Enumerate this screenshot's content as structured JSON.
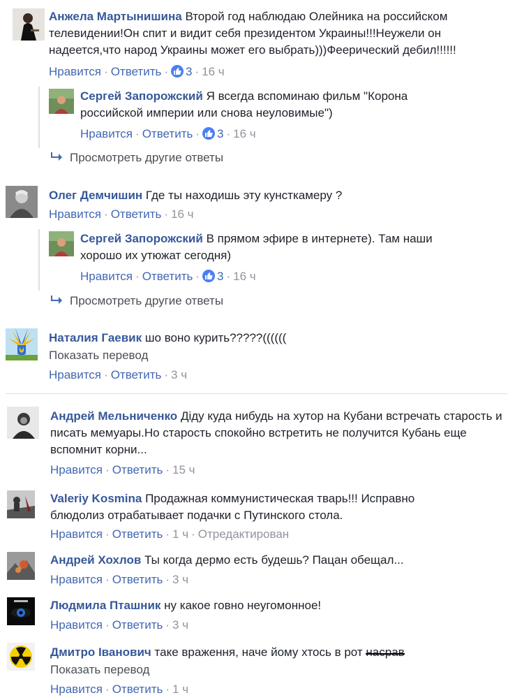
{
  "labels": {
    "like": "Нравится",
    "reply": "Ответить",
    "more_replies": "Просмотреть другие ответы",
    "translate": "Показать перевод",
    "edited": "Отредактирован"
  },
  "comments": [
    {
      "author": "Анжела Мартынишина",
      "text": "Второй год наблюдаю Олейника на российском телевидении!Он спит и видит себя президентом Украины!!!Неужели он надеется,что народ Украины может его выбрать)))Феерический дебил!!!!!!",
      "likes": "3",
      "time": "16 ч"
    },
    {
      "author": "Сергей Запорожский",
      "text": "Я всегда вспоминаю фильм \"Корона российской империи или снова неуловимые\")",
      "likes": "3",
      "time": "16 ч"
    },
    {
      "author": "Олег Демчишин",
      "text": "Где ты находишь эту кунсткамеру ?",
      "time": "16 ч"
    },
    {
      "author": "Сергей Запорожский",
      "text": "В прямом эфире в интернете). Там наши хорошо их утюжат сегодня)",
      "likes": "3",
      "time": "16 ч"
    },
    {
      "author": "Наталия Гаевик",
      "text": "шо воно курить?????((((((",
      "time": "3 ч"
    },
    {
      "author": "Андрей Мельниченко",
      "text": "Діду куда нибудь на хутор на Кубани встречать старость и писать мемуары.Но старость спокойно встретить не получится Кубань еще вспомнит корни...",
      "time": "15 ч"
    },
    {
      "author": "Valeriy Kosmina",
      "text": "Продажная коммунистическая тварь!!! Исправно блюдолиз отрабатывает подачки с Путинского стола.",
      "time": "1 ч"
    },
    {
      "author": "Андрей Хохлов",
      "text": "Ты когда дермо есть будешь? Пацан обещал...",
      "time": "3 ч"
    },
    {
      "author": "Людмила Пташник",
      "text": "ну какое говно неугомонное!",
      "time": "3 ч"
    },
    {
      "author": "Дмитро Іванович",
      "text_main": "таке враження, наче йому хтось в рот ",
      "text_struck": "насрав",
      "time": "1 ч"
    }
  ],
  "colors": {
    "author": "#365899",
    "link": "#4267b2",
    "muted": "#90949c",
    "like_badge": "#4a80f5"
  }
}
